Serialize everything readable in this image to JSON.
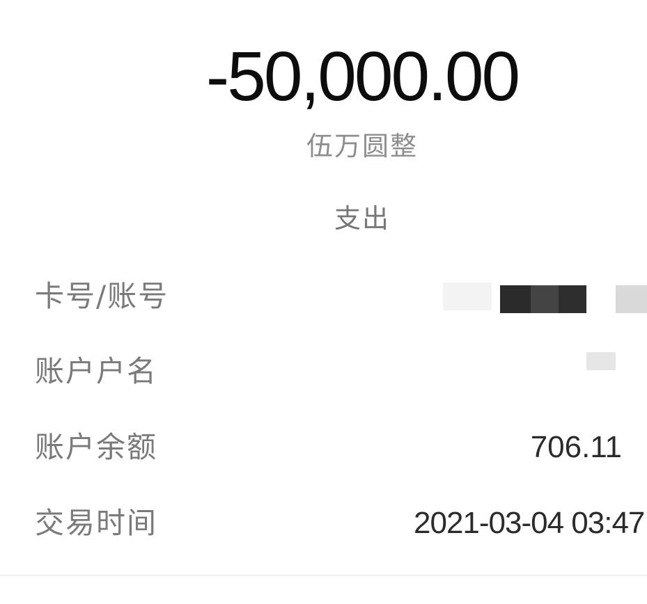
{
  "transaction": {
    "amount": "-50,000.00",
    "amount_in_words": "伍万圆整",
    "type": "支出"
  },
  "details": {
    "card_label": "卡号/账号",
    "name_label": "账户户名",
    "balance_label": "账户余额",
    "balance_value": "706.11",
    "time_label": "交易时间",
    "time_value": "2021-03-04 03:47"
  }
}
